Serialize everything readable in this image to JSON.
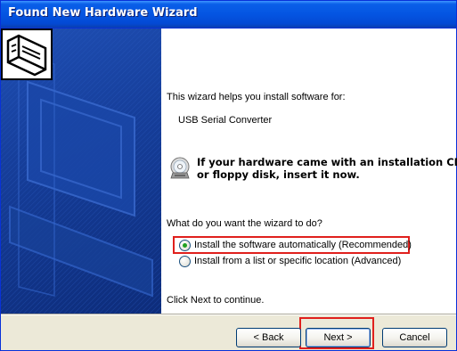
{
  "window": {
    "title": "Found New Hardware Wizard"
  },
  "content": {
    "intro": "This wizard helps you install software for:",
    "device_name": "USB Serial Converter",
    "cd_line1": "If your hardware came with an installation CD",
    "cd_line2": "or floppy disk, insert it now.",
    "question": "What do you want the wizard to do?",
    "options": [
      {
        "label": "Install the software automatically (Recommended)",
        "selected": true
      },
      {
        "label": "Install from a list or specific location (Advanced)",
        "selected": false
      }
    ],
    "continue_hint": "Click Next to continue."
  },
  "buttons": {
    "back": "< Back",
    "next": "Next >",
    "cancel": "Cancel"
  },
  "icons": {
    "hardware": "hardware-card-icon",
    "cd": "cd-disc-icon"
  },
  "colors": {
    "titlebar": "#0455e2",
    "banner": "#163e9a",
    "highlight": "#e0201d",
    "radio_selected": "#21a121"
  }
}
